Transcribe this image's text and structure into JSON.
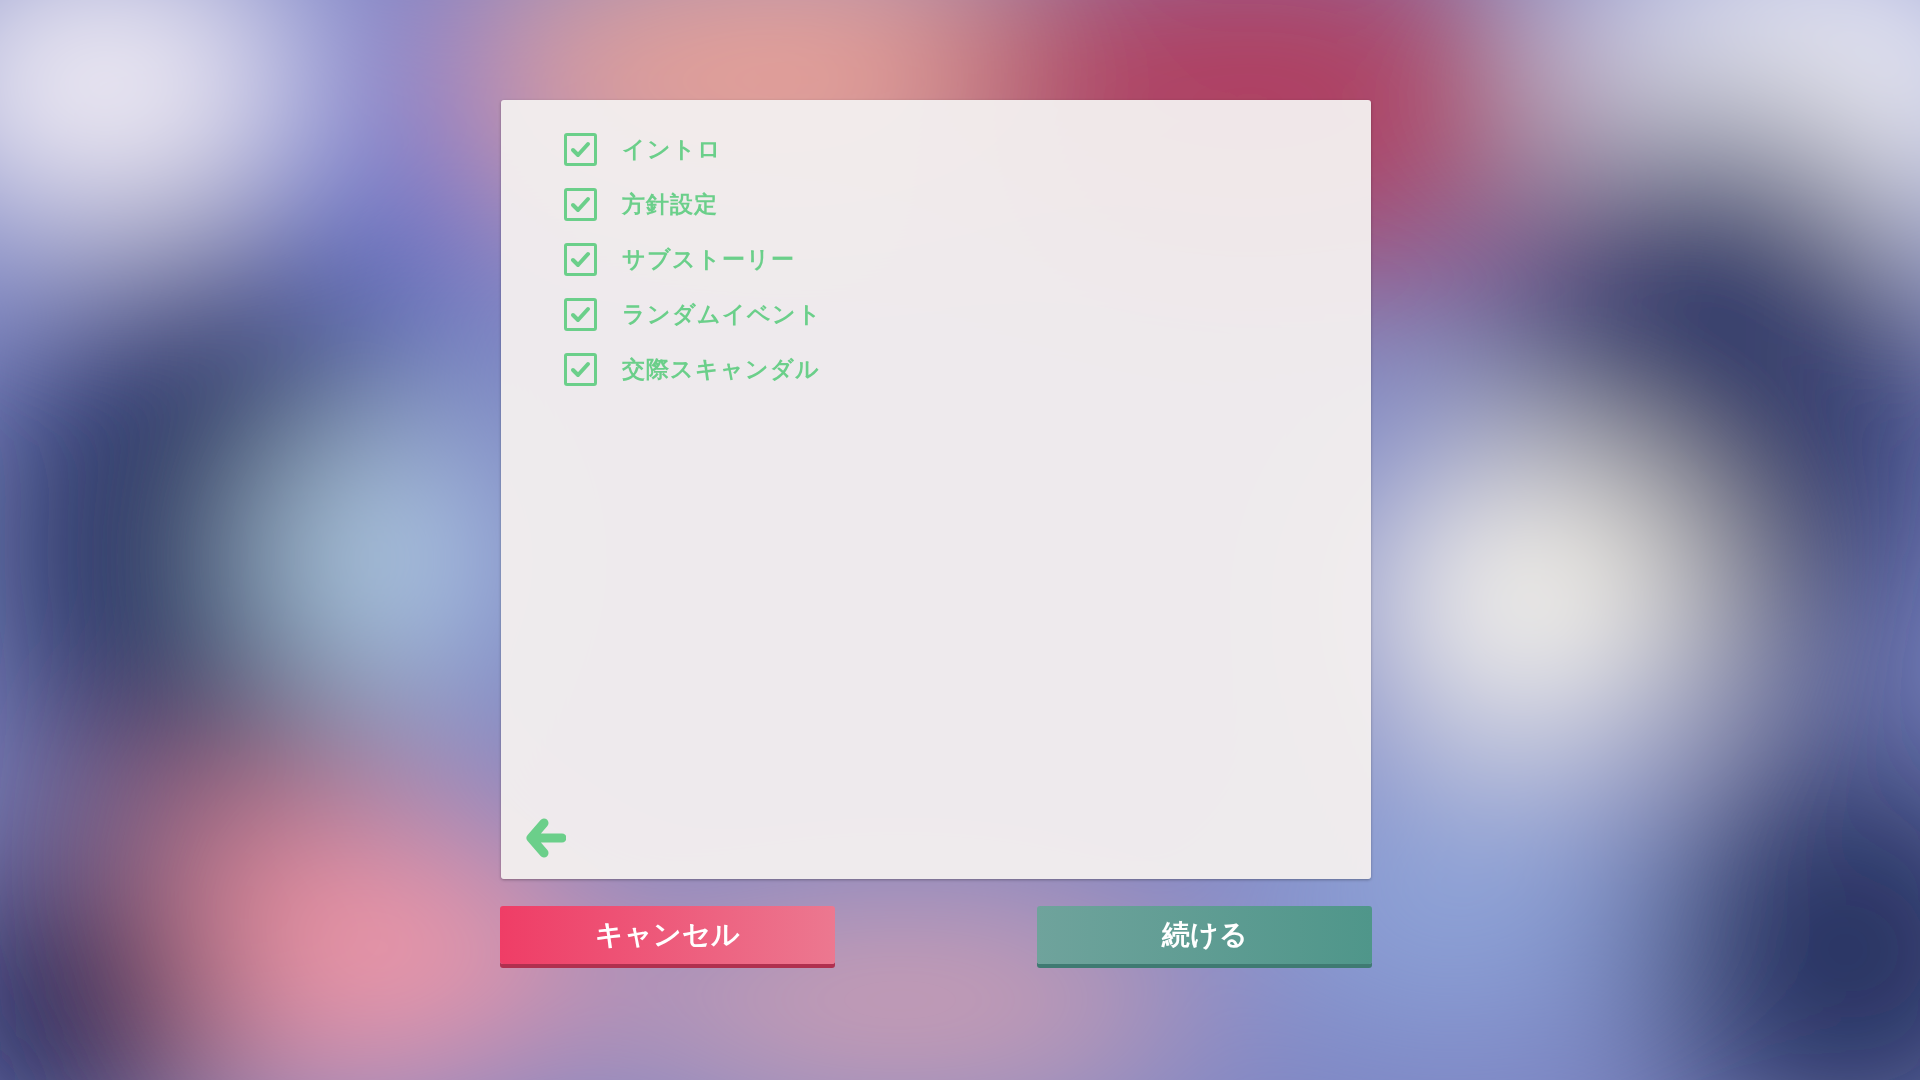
{
  "checklist": [
    {
      "label": "イントロ",
      "checked": true
    },
    {
      "label": "方針設定",
      "checked": true
    },
    {
      "label": "サブストーリー",
      "checked": true
    },
    {
      "label": "ランダムイベント",
      "checked": true
    },
    {
      "label": "交際スキャンダル",
      "checked": true
    }
  ],
  "buttons": [
    {
      "label": "キャンセル",
      "kind": "cancel"
    },
    {
      "label": "続ける",
      "kind": "continue"
    }
  ]
}
